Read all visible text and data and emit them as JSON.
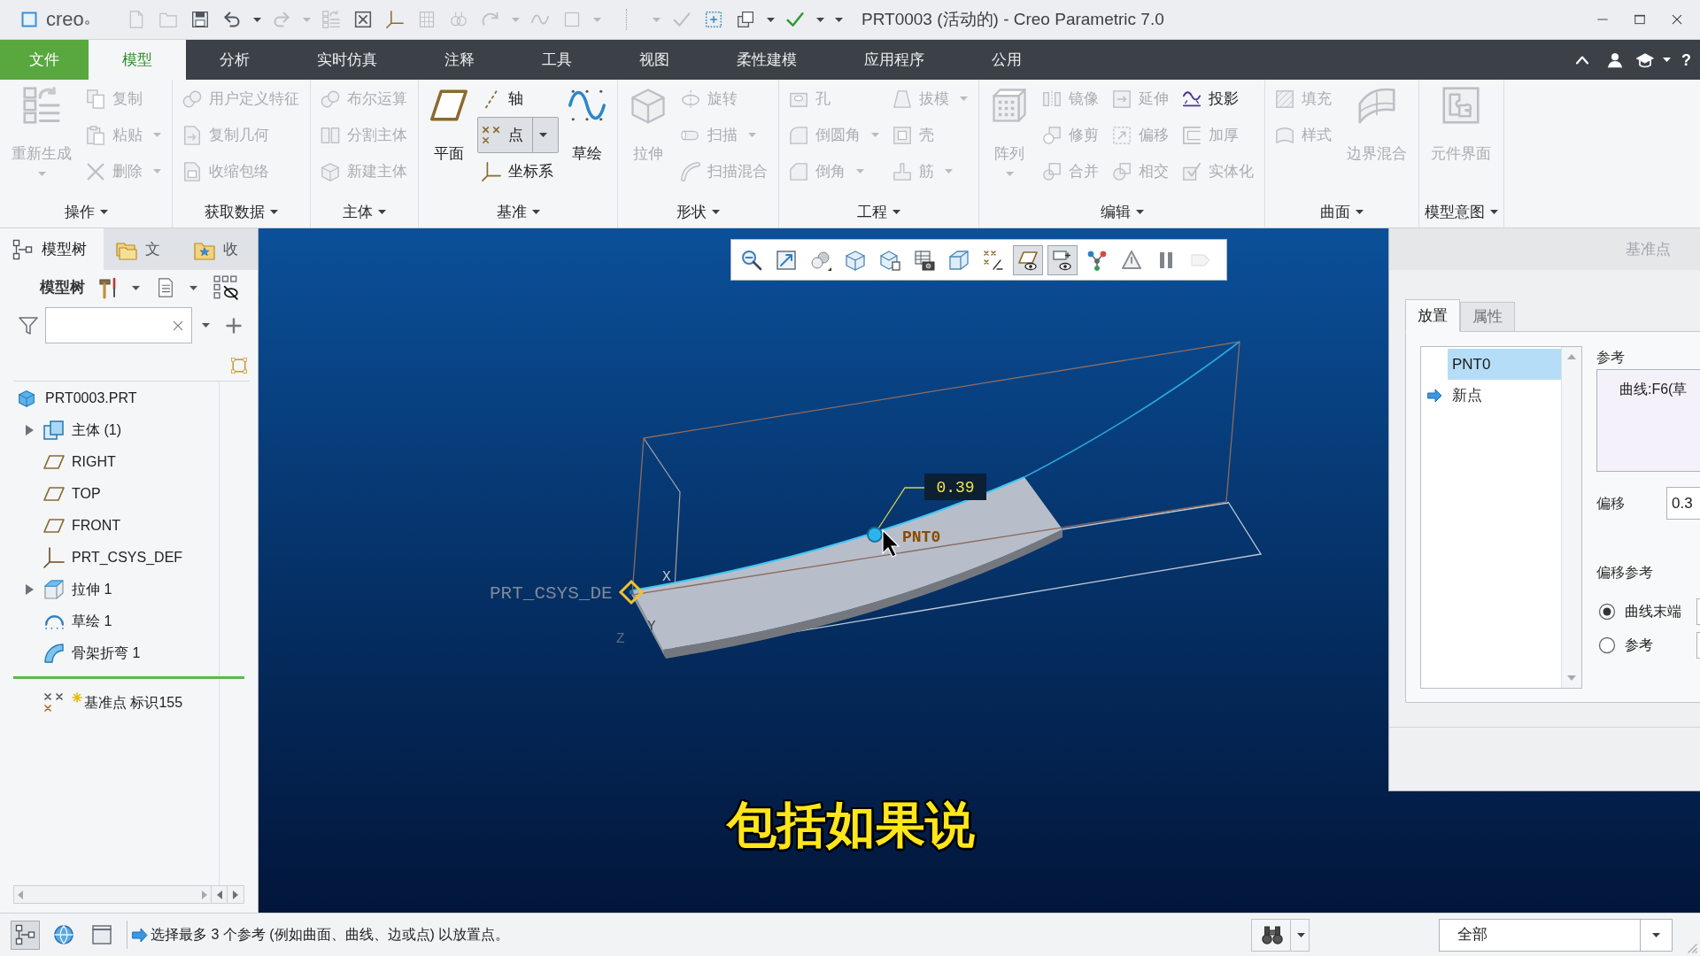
{
  "title_bar": {
    "logo": "creo",
    "title": "PRT0003 (活动的) - Creo Parametric 7.0"
  },
  "quick_access": [
    {
      "kind": "button",
      "disabled": true,
      "dropdown": false
    },
    {
      "kind": "button",
      "disabled": true,
      "dropdown": false
    },
    {
      "kind": "button",
      "disabled": false,
      "dropdown": false
    },
    {
      "kind": "button",
      "disabled": false,
      "dropdown": true
    },
    {
      "kind": "button",
      "disabled": true,
      "dropdown": true
    },
    {
      "kind": "button",
      "disabled": true,
      "dropdown": false
    },
    {
      "kind": "button",
      "disabled": false,
      "dropdown": false
    },
    {
      "kind": "button",
      "disabled": false,
      "dropdown": false
    },
    {
      "kind": "button",
      "disabled": true,
      "dropdown": false
    },
    {
      "kind": "button",
      "disabled": true,
      "dropdown": false
    },
    {
      "kind": "button",
      "disabled": true,
      "dropdown": true
    },
    {
      "kind": "button",
      "disabled": true,
      "dropdown": false
    },
    {
      "kind": "button",
      "disabled": true,
      "dropdown": true
    },
    {
      "kind": "separator"
    },
    {
      "kind": "menu",
      "disabled": true
    },
    {
      "kind": "button",
      "disabled": true,
      "dropdown": false
    },
    {
      "kind": "button",
      "disabled": false,
      "dropdown": false
    },
    {
      "kind": "button",
      "disabled": false,
      "dropdown": true
    },
    {
      "kind": "button",
      "disabled": false,
      "dropdown": true
    },
    {
      "kind": "menu",
      "disabled": false
    }
  ],
  "ribbon": {
    "tabs": [
      {
        "label": "文件",
        "kind": "file",
        "selected": false
      },
      {
        "label": "模型",
        "kind": "tab",
        "selected": true
      },
      {
        "label": "分析",
        "kind": "tab",
        "selected": false
      },
      {
        "label": "实时仿真",
        "kind": "tab",
        "selected": false
      },
      {
        "label": "注释",
        "kind": "tab",
        "selected": false
      },
      {
        "label": "工具",
        "kind": "tab",
        "selected": false
      },
      {
        "label": "视图",
        "kind": "tab",
        "selected": false
      },
      {
        "label": "柔性建模",
        "kind": "tab",
        "selected": false
      },
      {
        "label": "应用程序",
        "kind": "tab",
        "selected": false
      },
      {
        "label": "公用",
        "kind": "tab",
        "selected": false
      }
    ],
    "help": "?",
    "groups": [
      {
        "label": "操作",
        "dropdown": true,
        "columns": [
          {
            "kind": "large",
            "buttons": [
              {
                "label": "重新生成",
                "disabled": true,
                "pressed": false,
                "dropdown": true
              }
            ]
          },
          {
            "kind": "stack",
            "buttons": [
              {
                "label": "复制",
                "disabled": true,
                "pressed": false,
                "dropdown": false
              },
              {
                "label": "粘贴",
                "disabled": true,
                "pressed": false,
                "dropdown": true
              },
              {
                "label": "删除",
                "disabled": true,
                "pressed": false,
                "dropdown": true
              }
            ]
          }
        ]
      },
      {
        "label": "获取数据",
        "dropdown": true,
        "columns": [
          {
            "kind": "stack",
            "buttons": [
              {
                "label": "用户定义特征",
                "disabled": true,
                "pressed": false,
                "dropdown": false
              },
              {
                "label": "复制几何",
                "disabled": true,
                "pressed": false,
                "dropdown": false
              },
              {
                "label": "收缩包络",
                "disabled": true,
                "pressed": false,
                "dropdown": false
              }
            ]
          }
        ]
      },
      {
        "label": "主体",
        "dropdown": true,
        "columns": [
          {
            "kind": "stack",
            "buttons": [
              {
                "label": "布尔运算",
                "disabled": true,
                "pressed": false,
                "dropdown": false
              },
              {
                "label": "分割主体",
                "disabled": true,
                "pressed": false,
                "dropdown": false
              },
              {
                "label": "新建主体",
                "disabled": true,
                "pressed": false,
                "dropdown": false
              }
            ]
          }
        ]
      },
      {
        "label": "基准",
        "dropdown": true,
        "columns": [
          {
            "kind": "large",
            "buttons": [
              {
                "label": "平面",
                "disabled": false,
                "pressed": false,
                "dropdown": false
              }
            ]
          },
          {
            "kind": "stack",
            "buttons": [
              {
                "label": "轴",
                "disabled": false,
                "pressed": false,
                "dropdown": false
              },
              {
                "label": "点",
                "disabled": false,
                "pressed": true,
                "dropdown": true
              },
              {
                "label": "坐标系",
                "disabled": false,
                "pressed": false,
                "dropdown": false
              }
            ]
          },
          {
            "kind": "large",
            "buttons": [
              {
                "label": "草绘",
                "disabled": false,
                "pressed": false,
                "dropdown": false
              }
            ]
          }
        ]
      },
      {
        "label": "形状",
        "dropdown": true,
        "columns": [
          {
            "kind": "large",
            "buttons": [
              {
                "label": "拉伸",
                "disabled": true,
                "pressed": false,
                "dropdown": false
              }
            ]
          },
          {
            "kind": "stack",
            "buttons": [
              {
                "label": "旋转",
                "disabled": true,
                "pressed": false,
                "dropdown": false
              },
              {
                "label": "扫描",
                "disabled": true,
                "pressed": false,
                "dropdown": true
              },
              {
                "label": "扫描混合",
                "disabled": true,
                "pressed": false,
                "dropdown": false
              }
            ]
          }
        ]
      },
      {
        "label": "工程",
        "dropdown": true,
        "columns": [
          {
            "kind": "stack",
            "buttons": [
              {
                "label": "孔",
                "disabled": true,
                "pressed": false,
                "dropdown": false
              },
              {
                "label": "倒圆角",
                "disabled": true,
                "pressed": false,
                "dropdown": true
              },
              {
                "label": "倒角",
                "disabled": true,
                "pressed": false,
                "dropdown": true
              }
            ]
          },
          {
            "kind": "stack",
            "buttons": [
              {
                "label": "拔模",
                "disabled": true,
                "pressed": false,
                "dropdown": true
              },
              {
                "label": "壳",
                "disabled": true,
                "pressed": false,
                "dropdown": false
              },
              {
                "label": "筋",
                "disabled": true,
                "pressed": false,
                "dropdown": true
              }
            ]
          }
        ]
      },
      {
        "label": "编辑",
        "dropdown": true,
        "columns": [
          {
            "kind": "large",
            "buttons": [
              {
                "label": "阵列",
                "disabled": true,
                "pressed": false,
                "dropdown": true
              }
            ]
          },
          {
            "kind": "stack",
            "buttons": [
              {
                "label": "镜像",
                "disabled": true,
                "pressed": false,
                "dropdown": false
              },
              {
                "label": "修剪",
                "disabled": true,
                "pressed": false,
                "dropdown": false
              },
              {
                "label": "合并",
                "disabled": true,
                "pressed": false,
                "dropdown": false
              }
            ]
          },
          {
            "kind": "stack",
            "buttons": [
              {
                "label": "延伸",
                "disabled": true,
                "pressed": false,
                "dropdown": false
              },
              {
                "label": "偏移",
                "disabled": true,
                "pressed": false,
                "dropdown": false
              },
              {
                "label": "相交",
                "disabled": true,
                "pressed": false,
                "dropdown": false
              }
            ]
          },
          {
            "kind": "stack",
            "buttons": [
              {
                "label": "投影",
                "disabled": false,
                "pressed": false,
                "dropdown": false
              },
              {
                "label": "加厚",
                "disabled": true,
                "pressed": false,
                "dropdown": false
              },
              {
                "label": "实体化",
                "disabled": true,
                "pressed": false,
                "dropdown": false
              }
            ]
          }
        ]
      },
      {
        "label": "曲面",
        "dropdown": true,
        "columns": [
          {
            "kind": "stack",
            "buttons": [
              {
                "label": "填充",
                "disabled": true,
                "pressed": false,
                "dropdown": false
              },
              {
                "label": "样式",
                "disabled": true,
                "pressed": false,
                "dropdown": false
              }
            ]
          },
          {
            "kind": "large",
            "buttons": [
              {
                "label": "边界混合",
                "disabled": true,
                "pressed": false,
                "dropdown": false
              }
            ]
          }
        ]
      },
      {
        "label": "模型意图",
        "dropdown": true,
        "columns": [
          {
            "kind": "large",
            "buttons": [
              {
                "label": "元件界面",
                "disabled": true,
                "pressed": false,
                "dropdown": false
              }
            ]
          }
        ]
      }
    ]
  },
  "model_tree": {
    "tabs": [
      {
        "label": "模型树",
        "selected": true
      },
      {
        "label": "文",
        "selected": false
      },
      {
        "label": "收",
        "selected": false
      }
    ],
    "label": "模型树",
    "items": [
      {
        "label": "PRT0003.PRT",
        "kind": "part",
        "collapsed": false,
        "children": [
          {
            "label": "主体 (1)",
            "kind": "body",
            "collapsed": true
          },
          {
            "label": "RIGHT",
            "kind": "plane",
            "collapsed": false
          },
          {
            "label": "TOP",
            "kind": "plane",
            "collapsed": false
          },
          {
            "label": "FRONT",
            "kind": "plane",
            "collapsed": false
          },
          {
            "label": "PRT_CSYS_DEF",
            "kind": "csys",
            "collapsed": false
          },
          {
            "label": "拉伸 1",
            "kind": "extrude",
            "collapsed": true
          },
          {
            "label": "草绘 1",
            "kind": "sketch",
            "collapsed": false
          },
          {
            "label": "骨架折弯 1",
            "kind": "bend",
            "collapsed": false
          }
        ]
      }
    ],
    "new_items": [
      {
        "label": "基准点 标识155",
        "kind": "point",
        "new": true
      }
    ]
  },
  "viewport": {
    "toolbar": [
      {
        "pressed": false,
        "disabled": false
      },
      {
        "pressed": false,
        "disabled": false
      },
      {
        "pressed": false,
        "disabled": false
      },
      {
        "pressed": false,
        "disabled": false
      },
      {
        "pressed": false,
        "disabled": false
      },
      {
        "pressed": false,
        "disabled": false
      },
      {
        "pressed": false,
        "disabled": false
      },
      {
        "pressed": false,
        "disabled": false
      },
      {
        "pressed": true,
        "disabled": false
      },
      {
        "pressed": true,
        "disabled": false
      },
      {
        "pressed": false,
        "disabled": false
      },
      {
        "pressed": false,
        "disabled": false
      },
      {
        "pressed": false,
        "disabled": false
      },
      {
        "pressed": false,
        "disabled": true
      }
    ],
    "csys_label": "PRT_CSYS_DE",
    "axis_labels": [
      "X",
      "Y",
      "Z"
    ],
    "point_label": "PNT0",
    "dimension": "0.39",
    "caption": "包括如果说"
  },
  "dialog": {
    "title": "基准点",
    "tabs": [
      {
        "label": "放置",
        "selected": true
      },
      {
        "label": "属性",
        "selected": false
      }
    ],
    "points": [
      {
        "label": "PNT0",
        "kind": "point",
        "selected": true
      },
      {
        "label": "新点",
        "kind": "new",
        "selected": false
      }
    ],
    "reference_label": "参考",
    "references": [
      "曲线:F6(草"
    ],
    "offset_label": "偏移",
    "offset_value": "0.3",
    "offset_reference_label": "偏移参考",
    "offset_references": [
      {
        "label": "曲线末端",
        "selected": true
      },
      {
        "label": "参考",
        "selected": false
      }
    ]
  },
  "status_bar": {
    "toggles": [
      {
        "pressed": true
      },
      {
        "pressed": false
      },
      {
        "pressed": false
      }
    ],
    "message": "选择最多 3 个参考 (例如曲面、曲线、边或点) 以放置点。",
    "filter": "全部"
  }
}
